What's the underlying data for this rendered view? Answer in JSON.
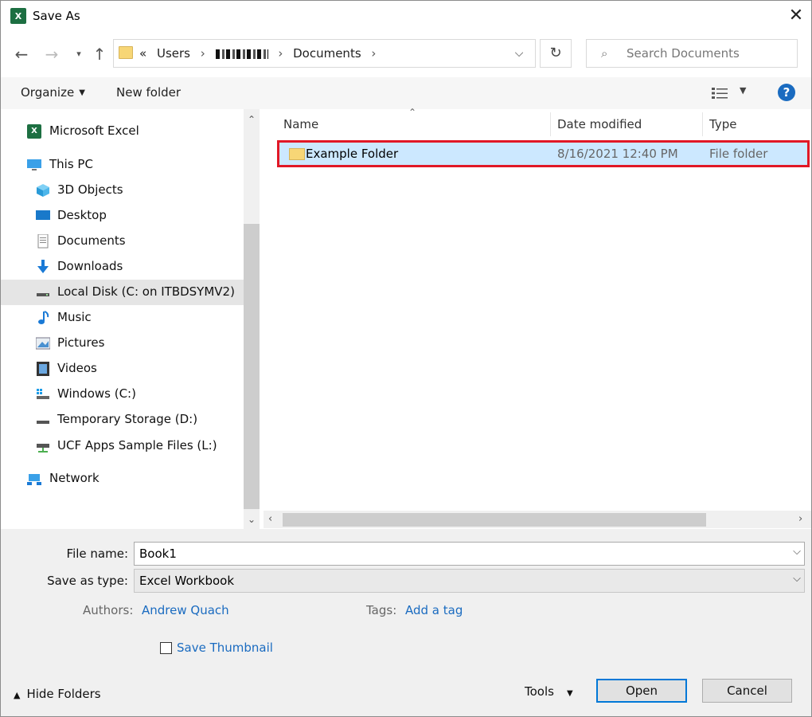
{
  "window": {
    "title": "Save As",
    "app_icon_letter": "X"
  },
  "address_bar": {
    "overflow": "«",
    "crumbs": [
      "Users",
      "Documents"
    ],
    "separator": "›"
  },
  "search": {
    "placeholder": "Search Documents"
  },
  "toolbar": {
    "organize": "Organize",
    "new_folder": "New folder",
    "help": "?"
  },
  "nav": {
    "items": [
      {
        "label": "Microsoft Excel",
        "icon": "excel-icon"
      },
      {
        "label": "This PC",
        "icon": "computer-icon"
      },
      {
        "label": "3D Objects",
        "icon": "cube-icon"
      },
      {
        "label": "Desktop",
        "icon": "desktop-icon"
      },
      {
        "label": "Documents",
        "icon": "document-icon"
      },
      {
        "label": "Downloads",
        "icon": "download-arrow-icon"
      },
      {
        "label": "Local Disk (C: on ITBDSYMV2)",
        "icon": "disk-icon",
        "selected": true
      },
      {
        "label": "Music",
        "icon": "music-note-icon"
      },
      {
        "label": "Pictures",
        "icon": "picture-icon"
      },
      {
        "label": "Videos",
        "icon": "video-icon"
      },
      {
        "label": "Windows (C:)",
        "icon": "windows-drive-icon"
      },
      {
        "label": "Temporary Storage (D:)",
        "icon": "disk-icon"
      },
      {
        "label": "UCF Apps Sample Files (L:)",
        "icon": "network-drive-icon"
      },
      {
        "label": "Network",
        "icon": "network-icon"
      }
    ]
  },
  "file_list": {
    "columns": {
      "name": "Name",
      "date": "Date modified",
      "type": "Type"
    },
    "rows": [
      {
        "name": "Example Folder",
        "date": "8/16/2021 12:40 PM",
        "type": "File folder",
        "selected": true
      }
    ]
  },
  "form": {
    "file_name_label": "File name:",
    "file_name_value": "Book1",
    "save_type_label": "Save as type:",
    "save_type_value": "Excel Workbook",
    "authors_label": "Authors:",
    "authors_value": "Andrew Quach",
    "tags_label": "Tags:",
    "tags_value": "Add a tag",
    "thumbnail_label": "Save Thumbnail"
  },
  "footer": {
    "hide_folders": "Hide Folders",
    "tools": "Tools",
    "open": "Open",
    "cancel": "Cancel"
  },
  "colors": {
    "accent": "#0078d7",
    "link": "#1a6bc0",
    "selection": "#cce8ff",
    "highlight_border": "#e11826",
    "excel_green": "#1d6f42",
    "folder_yellow": "#f7d676"
  }
}
